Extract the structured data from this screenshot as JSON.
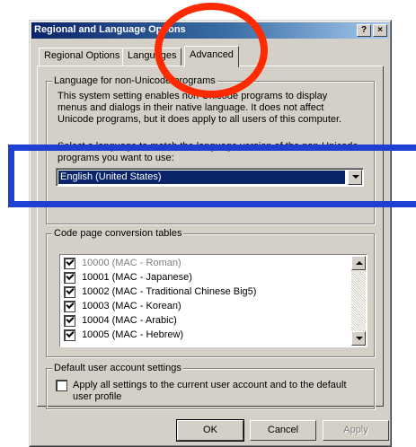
{
  "window": {
    "title": "Regional and Language Options",
    "help_button": "?",
    "close_button": "×"
  },
  "tabs": [
    {
      "label": "Regional Options",
      "active": false
    },
    {
      "label": "Languages",
      "active": false
    },
    {
      "label": "Advanced",
      "active": true
    }
  ],
  "non_unicode": {
    "group_label": "Language for non-Unicode programs",
    "description": "This system setting enables non-Unicode programs to display menus and dialogs in their native language. It does not affect Unicode programs, but it does apply to all users of this computer.",
    "prompt": "Select a language to match the language version of the non-Unicode programs you want to use:",
    "selected_language": "English (United States)"
  },
  "code_pages": {
    "group_label": "Code page conversion tables",
    "items": [
      {
        "label": "10000 (MAC - Roman)",
        "checked": true,
        "grayed": true
      },
      {
        "label": "10001 (MAC - Japanese)",
        "checked": true,
        "grayed": false
      },
      {
        "label": "10002 (MAC - Traditional Chinese Big5)",
        "checked": true,
        "grayed": false
      },
      {
        "label": "10003 (MAC - Korean)",
        "checked": true,
        "grayed": false
      },
      {
        "label": "10004 (MAC - Arabic)",
        "checked": true,
        "grayed": false
      },
      {
        "label": "10005 (MAC - Hebrew)",
        "checked": true,
        "grayed": false
      }
    ]
  },
  "default_user": {
    "group_label": "Default user account settings",
    "checkbox_label": "Apply all settings to the current user account and to the default user profile",
    "checked": false
  },
  "buttons": {
    "ok": "OK",
    "cancel": "Cancel",
    "apply": "Apply"
  },
  "annotations": {
    "circle_color": "#ff2a00",
    "rect_color": "#1e3fd1"
  }
}
